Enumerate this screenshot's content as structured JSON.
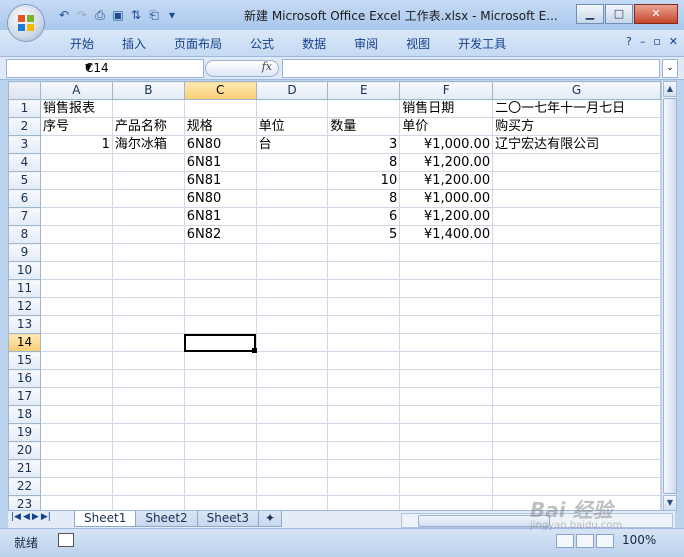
{
  "window": {
    "title": "新建 Microsoft Office Excel 工作表.xlsx - Microsoft E...",
    "controls": [
      "minimize",
      "maximize",
      "close"
    ]
  },
  "ribbon": {
    "tabs": [
      "开始",
      "插入",
      "页面布局",
      "公式",
      "数据",
      "审阅",
      "视图",
      "开发工具"
    ]
  },
  "formula_bar": {
    "name_box": "C14",
    "fx_label": "fx",
    "formula": ""
  },
  "columns": [
    "A",
    "B",
    "C",
    "D",
    "E",
    "F",
    "G"
  ],
  "selected": {
    "column": "C",
    "row": 14,
    "cell": "C14"
  },
  "rows": [
    {
      "n": "1",
      "cells": [
        "销售报表",
        "",
        "",
        "",
        "",
        "销售日期",
        "二〇一七年十一月七日"
      ]
    },
    {
      "n": "2",
      "cells": [
        "序号",
        "产品名称",
        "规格",
        "单位",
        "数量",
        "单价",
        "购买方"
      ]
    },
    {
      "n": "3",
      "cells": [
        "1",
        "海尔冰箱",
        "6N80",
        "台",
        "3",
        "¥1,000.00",
        "辽宁宏达有限公司"
      ]
    },
    {
      "n": "4",
      "cells": [
        "",
        "",
        "6N81",
        "",
        "8",
        "¥1,200.00",
        ""
      ]
    },
    {
      "n": "5",
      "cells": [
        "",
        "",
        "6N81",
        "",
        "10",
        "¥1,200.00",
        ""
      ]
    },
    {
      "n": "6",
      "cells": [
        "",
        "",
        "6N80",
        "",
        "8",
        "¥1,000.00",
        ""
      ]
    },
    {
      "n": "7",
      "cells": [
        "",
        "",
        "6N81",
        "",
        "6",
        "¥1,200.00",
        ""
      ]
    },
    {
      "n": "8",
      "cells": [
        "",
        "",
        "6N82",
        "",
        "5",
        "¥1,400.00",
        ""
      ]
    },
    {
      "n": "9",
      "cells": [
        "",
        "",
        "",
        "",
        "",
        "",
        ""
      ]
    },
    {
      "n": "10",
      "cells": [
        "",
        "",
        "",
        "",
        "",
        "",
        ""
      ]
    },
    {
      "n": "11",
      "cells": [
        "",
        "",
        "",
        "",
        "",
        "",
        ""
      ]
    },
    {
      "n": "12",
      "cells": [
        "",
        "",
        "",
        "",
        "",
        "",
        ""
      ]
    },
    {
      "n": "13",
      "cells": [
        "",
        "",
        "",
        "",
        "",
        "",
        ""
      ]
    },
    {
      "n": "14",
      "cells": [
        "",
        "",
        "",
        "",
        "",
        "",
        ""
      ]
    },
    {
      "n": "15",
      "cells": [
        "",
        "",
        "",
        "",
        "",
        "",
        ""
      ]
    },
    {
      "n": "16",
      "cells": [
        "",
        "",
        "",
        "",
        "",
        "",
        ""
      ]
    },
    {
      "n": "17",
      "cells": [
        "",
        "",
        "",
        "",
        "",
        "",
        ""
      ]
    },
    {
      "n": "18",
      "cells": [
        "",
        "",
        "",
        "",
        "",
        "",
        ""
      ]
    },
    {
      "n": "19",
      "cells": [
        "",
        "",
        "",
        "",
        "",
        "",
        ""
      ]
    },
    {
      "n": "20",
      "cells": [
        "",
        "",
        "",
        "",
        "",
        "",
        ""
      ]
    },
    {
      "n": "21",
      "cells": [
        "",
        "",
        "",
        "",
        "",
        "",
        ""
      ]
    },
    {
      "n": "22",
      "cells": [
        "",
        "",
        "",
        "",
        "",
        "",
        ""
      ]
    },
    {
      "n": "23",
      "cells": [
        "",
        "",
        "",
        "",
        "",
        "",
        ""
      ]
    }
  ],
  "sheets": [
    "Sheet1",
    "Sheet2",
    "Sheet3"
  ],
  "active_sheet": "Sheet1",
  "status": {
    "mode": "就绪",
    "zoom": "100%"
  },
  "watermark": {
    "text": "Bai 经验",
    "sub": "jingyan.baidu.com"
  },
  "colors": {
    "header_selected": "#f9cd73",
    "ribbon_text": "#15428b",
    "frame": "#bcd3ee"
  }
}
